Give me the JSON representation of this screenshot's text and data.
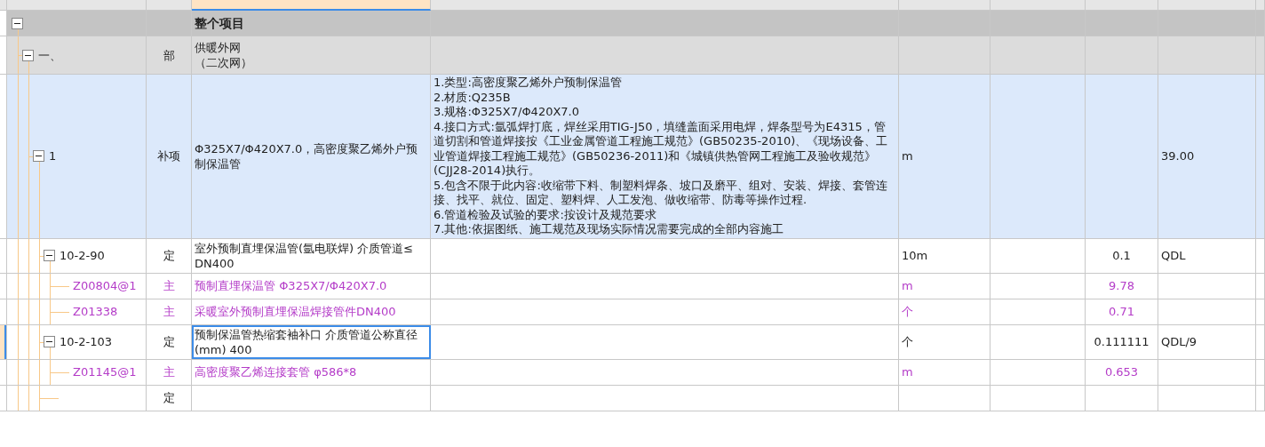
{
  "columns": [
    {
      "selected": false
    },
    {
      "selected": false
    },
    {
      "selected": true
    },
    {
      "selected": false
    },
    {
      "selected": false
    },
    {
      "selected": false
    },
    {
      "selected": false
    },
    {
      "selected": false
    }
  ],
  "rows": [
    {
      "kind": "project",
      "selected": false,
      "expanded": true,
      "name": "整个项目",
      "children": [
        {
          "kind": "part",
          "selected": false,
          "expanded": true,
          "code": "一、",
          "type": "部",
          "name": [
            "供暖外网",
            "（二次网）"
          ],
          "children": [
            {
              "kind": "item",
              "selected": false,
              "expanded": true,
              "code": "1",
              "type": "补项",
              "name": "Φ325X7/Φ420X7.0，高密度聚乙烯外户预制保温管",
              "features": [
                "1.类型:高密度聚乙烯外户预制保温管",
                "2.材质:Q235B",
                "3.规格:Φ325X7/Φ420X7.0",
                "4.接口方式:氩弧焊打底，焊丝采用TIG-J50，填缝盖面采用电焊，焊条型号为E4315，管道切割和管道焊接按《工业金属管道工程施工规范》(GB50235-2010)、《现场设备、工业管道焊接工程施工规范》(GB50236-2011)和《城镇供热管网工程施工及验收规范》(CJJ28-2014)执行。",
                "5.包含不限于此内容:收缩带下料、制塑料焊条、坡口及磨平、组对、安装、焊接、套管连接、找平、就位、固定、塑料焊、人工发泡、做收缩带、防毒等操作过程.",
                "6.管道检验及试验的要求:按设计及规范要求",
                "7.其他:依据图纸、施工规范及现场实际情况需要完成的全部内容施工"
              ],
              "unit": "m",
              "expr": "39.00",
              "children": [
                {
                  "kind": "quota",
                  "selected": false,
                  "expanded": true,
                  "code": "10-2-90",
                  "type": "定",
                  "name": "室外预制直埋保温管(氩电联焊) 介质管道≤ DN400",
                  "unit": "10m",
                  "qty": "0.1",
                  "expr": "QDL",
                  "children": [
                    {
                      "kind": "material",
                      "selected": false,
                      "code": "Z00804@1",
                      "type": "主",
                      "name": "预制直埋保温管 Φ325X7/Φ420X7.0",
                      "unit": "m",
                      "qty": "9.78"
                    },
                    {
                      "kind": "material",
                      "selected": false,
                      "code": "Z01338",
                      "type": "主",
                      "name": "采暖室外预制直埋保温焊接管件DN400",
                      "unit": "个",
                      "qty": "0.71"
                    }
                  ]
                },
                {
                  "kind": "quota",
                  "selected": true,
                  "expanded": true,
                  "code": "10-2-103",
                  "type": "定",
                  "name": "预制保温管热缩套袖补口 介质管道公称直径(mm) 400",
                  "unit": "个",
                  "qty": "0.111111",
                  "expr": "QDL/9",
                  "children": [
                    {
                      "kind": "material",
                      "selected": false,
                      "code": "Z01145@1",
                      "type": "主",
                      "name": "高密度聚乙烯连接套管 φ586*8",
                      "unit": "m",
                      "qty": "0.653"
                    }
                  ]
                },
                {
                  "kind": "quota",
                  "selected": false,
                  "type": "定"
                }
              ]
            }
          ]
        }
      ]
    }
  ]
}
